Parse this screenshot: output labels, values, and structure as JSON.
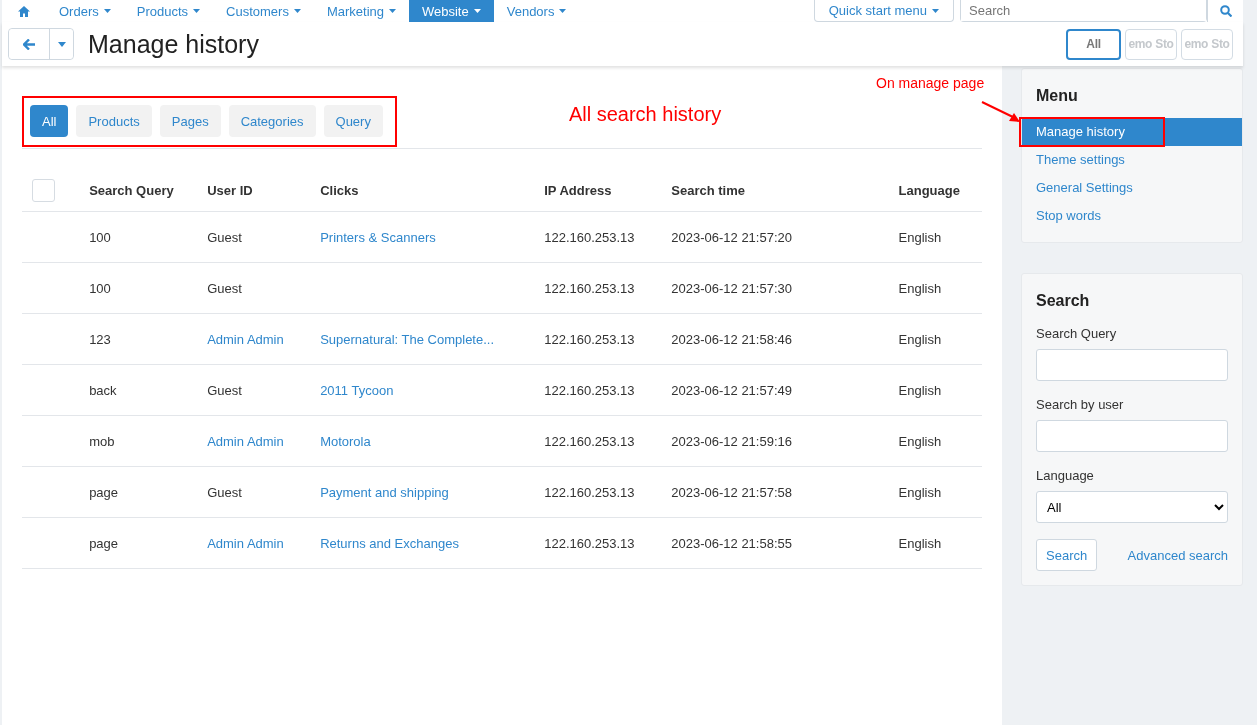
{
  "top_nav": {
    "items": [
      {
        "label": "Orders",
        "selected": false
      },
      {
        "label": "Products",
        "selected": false
      },
      {
        "label": "Customers",
        "selected": false
      },
      {
        "label": "Marketing",
        "selected": false
      },
      {
        "label": "Website",
        "selected": true
      },
      {
        "label": "Vendors",
        "selected": false
      }
    ],
    "quick_start": "Quick start menu",
    "search": {
      "placeholder": "Search"
    }
  },
  "header": {
    "title": "Manage history",
    "storefronts": [
      {
        "label": "All",
        "selected": true
      },
      {
        "label": "emo Sto",
        "selected": false
      },
      {
        "label": "emo Sto",
        "selected": false
      }
    ]
  },
  "tabs": [
    {
      "label": "All",
      "selected": true
    },
    {
      "label": "Products",
      "selected": false
    },
    {
      "label": "Pages",
      "selected": false
    },
    {
      "label": "Categories",
      "selected": false
    },
    {
      "label": "Query",
      "selected": false
    }
  ],
  "annotations": {
    "tabs_note": "All search history",
    "menu_note": "On manage page"
  },
  "table": {
    "select_all": {
      "checked": false
    },
    "columns": [
      "Search Query",
      "User ID",
      "Clicks",
      "IP Address",
      "Search time",
      "Language"
    ],
    "rows": [
      {
        "query": "100",
        "user": "Guest",
        "user_link": false,
        "clicks": "Printers & Scanners",
        "ip": "122.160.253.13",
        "time": "2023-06-12 21:57:20",
        "language": "English"
      },
      {
        "query": "100",
        "user": "Guest",
        "user_link": false,
        "ip": "122.160.253.13",
        "time": "2023-06-12 21:57:30",
        "language": "English"
      },
      {
        "query": "123",
        "user": "Admin Admin",
        "user_link": true,
        "clicks": "Supernatural: The Complete...",
        "ip": "122.160.253.13",
        "time": "2023-06-12 21:58:46",
        "language": "English"
      },
      {
        "query": "back",
        "user": "Guest",
        "user_link": false,
        "clicks": "2011 Tycoon",
        "ip": "122.160.253.13",
        "time": "2023-06-12 21:57:49",
        "language": "English"
      },
      {
        "query": "mob",
        "user": "Admin Admin",
        "user_link": true,
        "clicks": "Motorola",
        "ip": "122.160.253.13",
        "time": "2023-06-12 21:59:16",
        "language": "English"
      },
      {
        "query": "page",
        "user": "Guest",
        "user_link": false,
        "clicks": "Payment and shipping",
        "ip": "122.160.253.13",
        "time": "2023-06-12 21:57:58",
        "language": "English"
      },
      {
        "query": "page",
        "user": "Admin Admin",
        "user_link": true,
        "clicks": "Returns and Exchanges",
        "ip": "122.160.253.13",
        "time": "2023-06-12 21:58:55",
        "language": "English"
      }
    ]
  },
  "sidebar": {
    "menu": {
      "title": "Menu",
      "items": [
        {
          "label": "Manage history",
          "selected": true
        },
        {
          "label": "Theme settings",
          "selected": false
        },
        {
          "label": "General Settings",
          "selected": false
        },
        {
          "label": "Stop words",
          "selected": false
        }
      ]
    },
    "search": {
      "title": "Search",
      "fields": [
        {
          "kind": "text",
          "label": "Search Query"
        },
        {
          "kind": "text",
          "label": "Search by user"
        },
        {
          "kind": "select",
          "label": "Language",
          "value": "All"
        }
      ],
      "button": "Search",
      "link": "Advanced search"
    }
  }
}
